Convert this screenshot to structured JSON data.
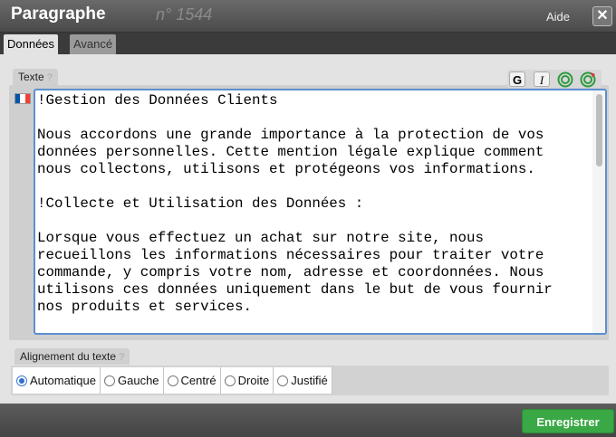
{
  "window": {
    "title": "Paragraphe",
    "subtitle": "n° 1544",
    "help": "Aide",
    "close_icon": "close-icon"
  },
  "tabs": [
    {
      "label": "Données",
      "active": true
    },
    {
      "label": "Avancé",
      "active": false
    }
  ],
  "texte": {
    "label": "Texte",
    "help_mark": "?",
    "toolbar": {
      "bold": "G",
      "italic": "I",
      "icons": [
        "circle-icon",
        "circle-refresh-icon"
      ],
      "icon_color": "#2e9a3e",
      "icon2_accent": "#d43a3a"
    },
    "language_icon": "flag-fr-icon",
    "flag_colors": [
      "#0055a4",
      "#ffffff",
      "#ef4135"
    ],
    "content": "!Gestion des Données Clients\n\nNous accordons une grande importance à la protection de vos\ndonnées personnelles. Cette mention légale explique comment\nnous collectons, utilisons et protégeons vos informations.\n\n!Collecte et Utilisation des Données :\n\nLorsque vous effectuez un achat sur notre site, nous\nrecueillons les informations nécessaires pour traiter votre\ncommande, y compris votre nom, adresse et coordonnées. Nous\nutilisons ces données uniquement dans le but de vous fournir\nnos produits et services."
  },
  "alignment": {
    "label": "Alignement du texte",
    "help_mark": "?",
    "options": [
      {
        "label": "Automatique",
        "selected": true
      },
      {
        "label": "Gauche",
        "selected": false
      },
      {
        "label": "Centré",
        "selected": false
      },
      {
        "label": "Droite",
        "selected": false
      },
      {
        "label": "Justifié",
        "selected": false
      }
    ]
  },
  "footer": {
    "save_label": "Enregistrer",
    "save_color": "#39a845"
  }
}
